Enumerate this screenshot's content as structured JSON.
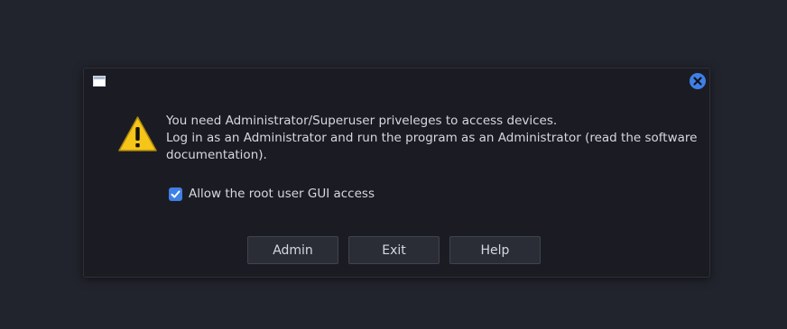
{
  "dialog": {
    "message_lines": [
      "You need Administrator/Superuser priveleges to access devices.",
      "Log in as an Administrator and run the program as an Administrator (read the software",
      "documentation)."
    ],
    "checkbox": {
      "label": "Allow the root user GUI access",
      "checked": true
    },
    "buttons": {
      "admin": "Admin",
      "exit": "Exit",
      "help": "Help"
    },
    "icons": {
      "window": "window-icon",
      "close": "close-icon",
      "warning": "warning-icon",
      "check": "checkmark-icon"
    },
    "colors": {
      "accent": "#3f7fe6",
      "warning": "#f5c518",
      "background": "#22242d",
      "dialog_bg": "#1b1c23",
      "text": "#d6d8de"
    }
  }
}
